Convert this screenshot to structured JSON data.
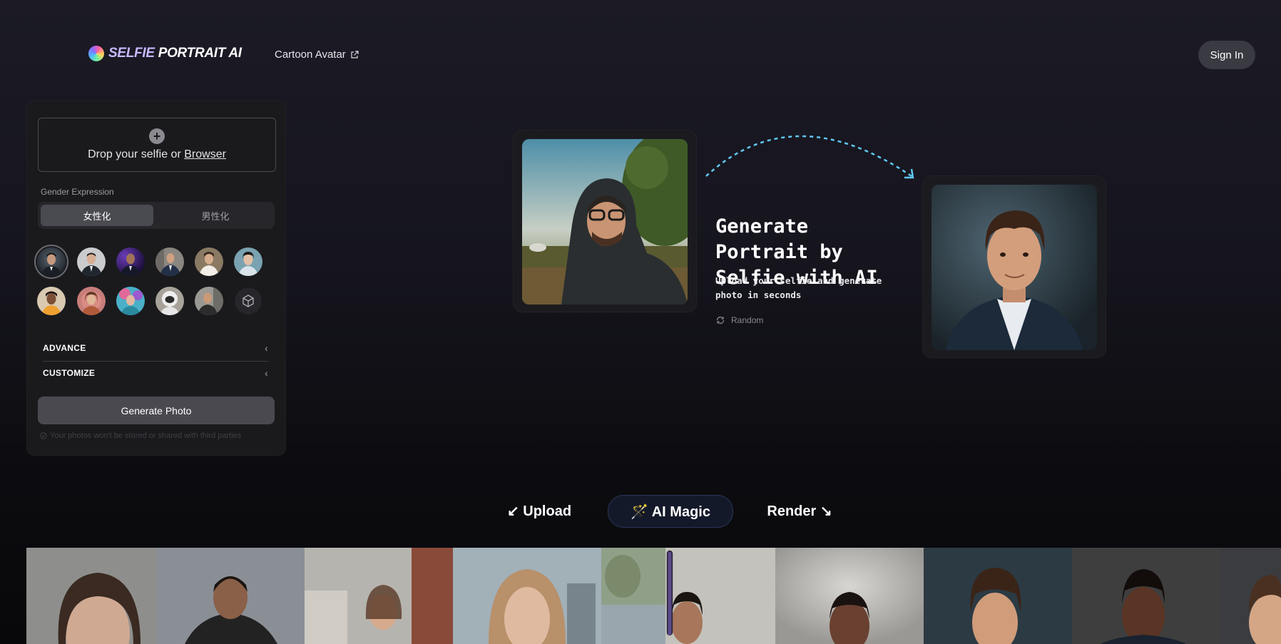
{
  "header": {
    "logo_part1": "SELFIE",
    "logo_part2": "PORTRAIT AI",
    "nav_link": "Cartoon Avatar",
    "signin": "Sign In"
  },
  "upload": {
    "drop_text": "Drop your selfie or ",
    "browse_link": "Browser"
  },
  "gender": {
    "label": "Gender Expression",
    "options": [
      "女性化",
      "男性化"
    ],
    "selected": "女性化"
  },
  "style_presets_count": 11,
  "advanced": {
    "advance_label": "ADVANCE",
    "customize_label": "CUSTOMIZE"
  },
  "generate_button": "Generate Photo",
  "privacy_note": "Your photos won't be stored or shared with third parties",
  "hero": {
    "title": "Generate Portrait by Selfie with AI",
    "subtitle": "Upload your selfie and generate photo in seconds",
    "random_label": "Random"
  },
  "steps": {
    "upload": "↙ Upload",
    "magic": "🪄 AI Magic",
    "render": "Render ↘"
  },
  "colors": {
    "accent_arrow": "#5fc8f0",
    "panel_bg": "#1a1a1d",
    "button_bg": "#4a4950"
  }
}
